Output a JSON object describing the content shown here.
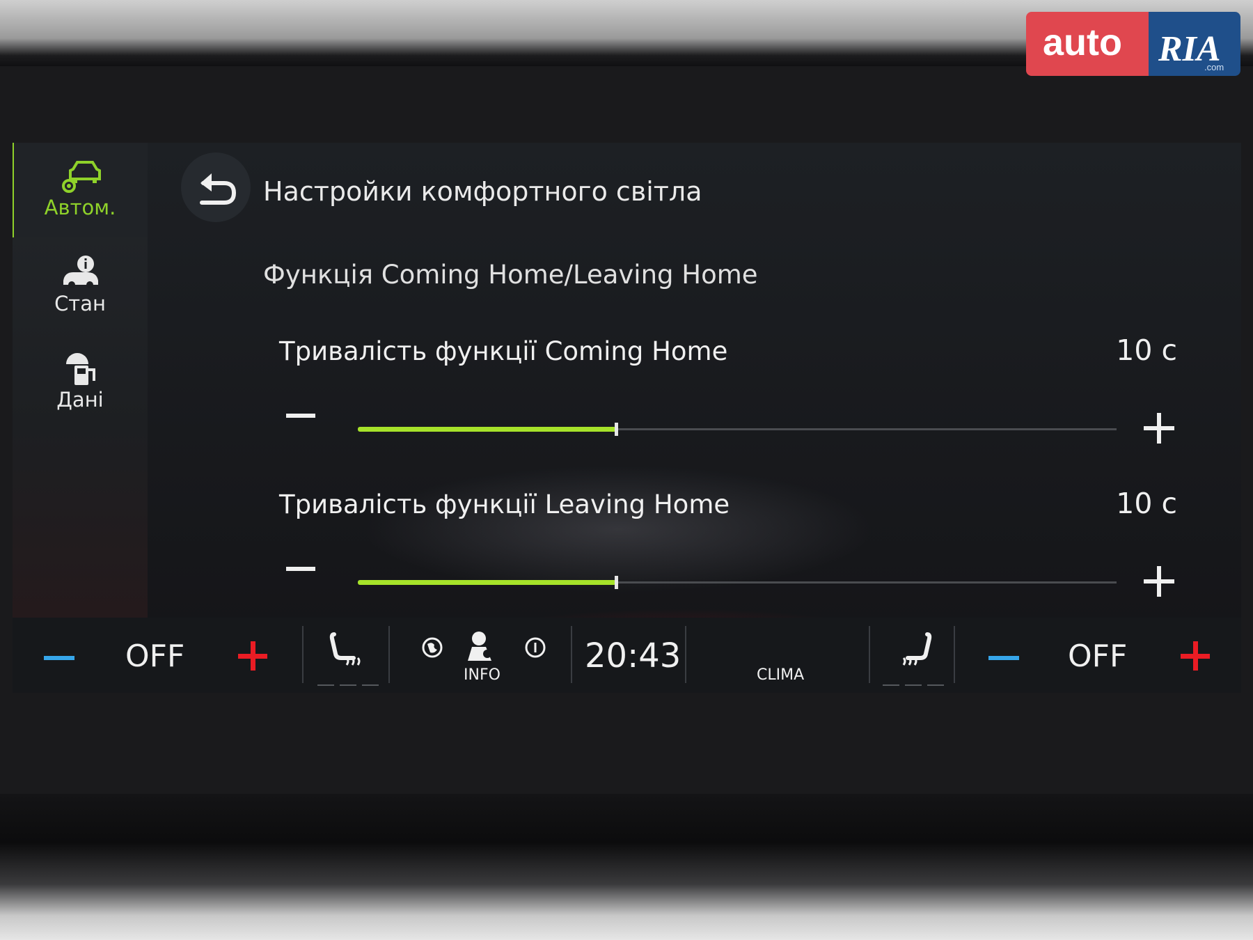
{
  "watermark": {
    "brand": "auto RIA .com"
  },
  "sidebar": {
    "items": [
      {
        "label": "Автом.",
        "icon": "car-settings-icon",
        "active": true
      },
      {
        "label": "Стан",
        "icon": "car-info-icon",
        "active": false
      },
      {
        "label": "Дані",
        "icon": "fuel-data-icon",
        "active": false
      }
    ]
  },
  "header": {
    "title": "Настройки комфортного світла",
    "back_icon": "back-arrow-icon"
  },
  "section": {
    "title": "Функція Coming Home/Leaving Home"
  },
  "settings": [
    {
      "label": "Тривалість функції Coming Home",
      "value": "10 с",
      "level": 0.34
    },
    {
      "label": "Тривалість функції Leaving Home",
      "value": "10 с",
      "level": 0.34
    }
  ],
  "bottom_bar": {
    "left_temp": "OFF",
    "right_temp": "OFF",
    "clock": "20:43",
    "info_label": "INFO",
    "clima_label": "CLIMA"
  },
  "colors": {
    "accent": "#8fd22a",
    "slider_fill": "#a6e22a",
    "minus": "#36a6ea",
    "plus": "#ea1c24"
  }
}
